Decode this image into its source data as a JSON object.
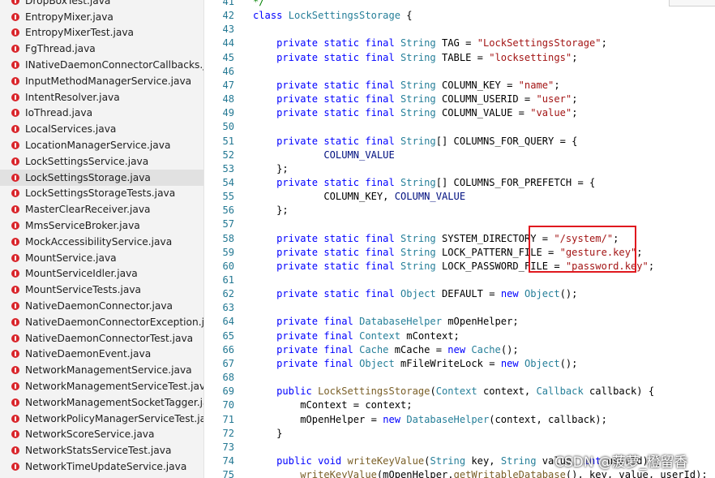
{
  "sidebar": {
    "active_index": 11,
    "files": [
      "DropBoxTest.java",
      "EntropyMixer.java",
      "EntropyMixerTest.java",
      "FgThread.java",
      "INativeDaemonConnectorCallbacks.java",
      "InputMethodManagerService.java",
      "IntentResolver.java",
      "IoThread.java",
      "LocalServices.java",
      "LocationManagerService.java",
      "LockSettingsService.java",
      "LockSettingsStorage.java",
      "LockSettingsStorageTests.java",
      "MasterClearReceiver.java",
      "MmsServiceBroker.java",
      "MockAccessibilityService.java",
      "MountService.java",
      "MountServiceIdler.java",
      "MountServiceTests.java",
      "NativeDaemonConnector.java",
      "NativeDaemonConnectorException.java",
      "NativeDaemonConnectorTest.java",
      "NativeDaemonEvent.java",
      "NetworkManagementService.java",
      "NetworkManagementServiceTest.java",
      "NetworkManagementSocketTagger.java",
      "NetworkPolicyManagerServiceTest.java",
      "NetworkScoreService.java",
      "NetworkStatsServiceTest.java",
      "NetworkTimeUpdateService.java"
    ]
  },
  "editor": {
    "lines": [
      {
        "n": "41",
        "tokens": [
          [
            "cm",
            "*/"
          ]
        ]
      },
      {
        "n": "42",
        "tokens": [
          [
            "kw",
            "class "
          ],
          [
            "ty",
            "LockSettingsStorage"
          ],
          [
            "pl",
            " {"
          ]
        ]
      },
      {
        "n": "43",
        "tokens": []
      },
      {
        "n": "44",
        "tokens": [
          [
            "pl",
            "    "
          ],
          [
            "kw",
            "private static final "
          ],
          [
            "ty",
            "String"
          ],
          [
            "pl",
            " TAG = "
          ],
          [
            "st",
            "\"LockSettingsStorage\""
          ],
          [
            "pl",
            ";"
          ]
        ]
      },
      {
        "n": "45",
        "tokens": [
          [
            "pl",
            "    "
          ],
          [
            "kw",
            "private static final "
          ],
          [
            "ty",
            "String"
          ],
          [
            "pl",
            " TABLE = "
          ],
          [
            "st",
            "\"locksettings\""
          ],
          [
            "pl",
            ";"
          ]
        ]
      },
      {
        "n": "46",
        "tokens": []
      },
      {
        "n": "47",
        "tokens": [
          [
            "pl",
            "    "
          ],
          [
            "kw",
            "private static final "
          ],
          [
            "ty",
            "String"
          ],
          [
            "pl",
            " COLUMN_KEY = "
          ],
          [
            "st",
            "\"name\""
          ],
          [
            "pl",
            ";"
          ]
        ]
      },
      {
        "n": "48",
        "tokens": [
          [
            "pl",
            "    "
          ],
          [
            "kw",
            "private static final "
          ],
          [
            "ty",
            "String"
          ],
          [
            "pl",
            " COLUMN_USERID = "
          ],
          [
            "st",
            "\"user\""
          ],
          [
            "pl",
            ";"
          ]
        ]
      },
      {
        "n": "49",
        "tokens": [
          [
            "pl",
            "    "
          ],
          [
            "kw",
            "private static final "
          ],
          [
            "ty",
            "String"
          ],
          [
            "pl",
            " COLUMN_VALUE = "
          ],
          [
            "st",
            "\"value\""
          ],
          [
            "pl",
            ";"
          ]
        ]
      },
      {
        "n": "50",
        "tokens": []
      },
      {
        "n": "51",
        "tokens": [
          [
            "pl",
            "    "
          ],
          [
            "kw",
            "private static final "
          ],
          [
            "ty",
            "String"
          ],
          [
            "pl",
            "[] COLUMNS_FOR_QUERY = {"
          ]
        ]
      },
      {
        "n": "52",
        "tokens": [
          [
            "pl",
            "            "
          ],
          [
            "vr",
            "COLUMN_VALUE"
          ]
        ]
      },
      {
        "n": "53",
        "tokens": [
          [
            "pl",
            "    };"
          ]
        ]
      },
      {
        "n": "54",
        "tokens": [
          [
            "pl",
            "    "
          ],
          [
            "kw",
            "private static final "
          ],
          [
            "ty",
            "String"
          ],
          [
            "pl",
            "[] COLUMNS_FOR_PREFETCH = {"
          ]
        ]
      },
      {
        "n": "55",
        "tokens": [
          [
            "pl",
            "            COLUMN_KEY, "
          ],
          [
            "vr",
            "COLUMN_VALUE"
          ]
        ]
      },
      {
        "n": "56",
        "tokens": [
          [
            "pl",
            "    };"
          ]
        ]
      },
      {
        "n": "57",
        "tokens": []
      },
      {
        "n": "58",
        "tokens": [
          [
            "pl",
            "    "
          ],
          [
            "kw",
            "private static final "
          ],
          [
            "ty",
            "String"
          ],
          [
            "pl",
            " SYSTEM_DIRECTORY = "
          ],
          [
            "st",
            "\"/system/\""
          ],
          [
            "pl",
            ";"
          ]
        ]
      },
      {
        "n": "59",
        "tokens": [
          [
            "pl",
            "    "
          ],
          [
            "kw",
            "private static final "
          ],
          [
            "ty",
            "String"
          ],
          [
            "pl",
            " LOCK_PATTERN_FILE = "
          ],
          [
            "st",
            "\"gesture.key\""
          ],
          [
            "pl",
            ";"
          ]
        ]
      },
      {
        "n": "60",
        "tokens": [
          [
            "pl",
            "    "
          ],
          [
            "kw",
            "private static final "
          ],
          [
            "ty",
            "String"
          ],
          [
            "pl",
            " LOCK_PASSWORD_FILE = "
          ],
          [
            "st",
            "\"password.key\""
          ],
          [
            "pl",
            ";"
          ]
        ]
      },
      {
        "n": "61",
        "tokens": []
      },
      {
        "n": "62",
        "tokens": [
          [
            "pl",
            "    "
          ],
          [
            "kw",
            "private static final "
          ],
          [
            "ty",
            "Object"
          ],
          [
            "pl",
            " DEFAULT = "
          ],
          [
            "kw",
            "new "
          ],
          [
            "ty",
            "Object"
          ],
          [
            "pl",
            "();"
          ]
        ]
      },
      {
        "n": "63",
        "tokens": []
      },
      {
        "n": "64",
        "tokens": [
          [
            "pl",
            "    "
          ],
          [
            "kw",
            "private final "
          ],
          [
            "ty",
            "DatabaseHelper"
          ],
          [
            "pl",
            " mOpenHelper;"
          ]
        ]
      },
      {
        "n": "65",
        "tokens": [
          [
            "pl",
            "    "
          ],
          [
            "kw",
            "private final "
          ],
          [
            "ty",
            "Context"
          ],
          [
            "pl",
            " mContext;"
          ]
        ]
      },
      {
        "n": "66",
        "tokens": [
          [
            "pl",
            "    "
          ],
          [
            "kw",
            "private final "
          ],
          [
            "ty",
            "Cache"
          ],
          [
            "pl",
            " mCache = "
          ],
          [
            "kw",
            "new "
          ],
          [
            "ty",
            "Cache"
          ],
          [
            "pl",
            "();"
          ]
        ]
      },
      {
        "n": "67",
        "tokens": [
          [
            "pl",
            "    "
          ],
          [
            "kw",
            "private final "
          ],
          [
            "ty",
            "Object"
          ],
          [
            "pl",
            " mFileWriteLock = "
          ],
          [
            "kw",
            "new "
          ],
          [
            "ty",
            "Object"
          ],
          [
            "pl",
            "();"
          ]
        ]
      },
      {
        "n": "68",
        "tokens": []
      },
      {
        "n": "69",
        "tokens": [
          [
            "pl",
            "    "
          ],
          [
            "kw",
            "public "
          ],
          [
            "fn",
            "LockSettingsStorage"
          ],
          [
            "pl",
            "("
          ],
          [
            "ty",
            "Context"
          ],
          [
            "pl",
            " context, "
          ],
          [
            "ty",
            "Callback"
          ],
          [
            "pl",
            " callback) {"
          ]
        ]
      },
      {
        "n": "70",
        "tokens": [
          [
            "pl",
            "        mContext = context;"
          ]
        ]
      },
      {
        "n": "71",
        "tokens": [
          [
            "pl",
            "        mOpenHelper = "
          ],
          [
            "kw",
            "new "
          ],
          [
            "ty",
            "DatabaseHelper"
          ],
          [
            "pl",
            "(context, callback);"
          ]
        ]
      },
      {
        "n": "72",
        "tokens": [
          [
            "pl",
            "    }"
          ]
        ]
      },
      {
        "n": "73",
        "tokens": []
      },
      {
        "n": "74",
        "tokens": [
          [
            "pl",
            "    "
          ],
          [
            "kw",
            "public void "
          ],
          [
            "fn",
            "writeKeyValue"
          ],
          [
            "pl",
            "("
          ],
          [
            "ty",
            "String"
          ],
          [
            "pl",
            " key, "
          ],
          [
            "ty",
            "String"
          ],
          [
            "pl",
            " value, "
          ],
          [
            "kw",
            "int"
          ],
          [
            "pl",
            " userId) {"
          ]
        ]
      },
      {
        "n": "75",
        "tokens": [
          [
            "pl",
            "        "
          ],
          [
            "fn",
            "writeKeyValue"
          ],
          [
            "pl",
            "(mOpenHelper."
          ],
          [
            "fn",
            "getWritableDatabase"
          ],
          [
            "pl",
            "(), key, value, userId);"
          ]
        ]
      }
    ]
  },
  "watermark": "CSDN @菠萝_橙留香"
}
